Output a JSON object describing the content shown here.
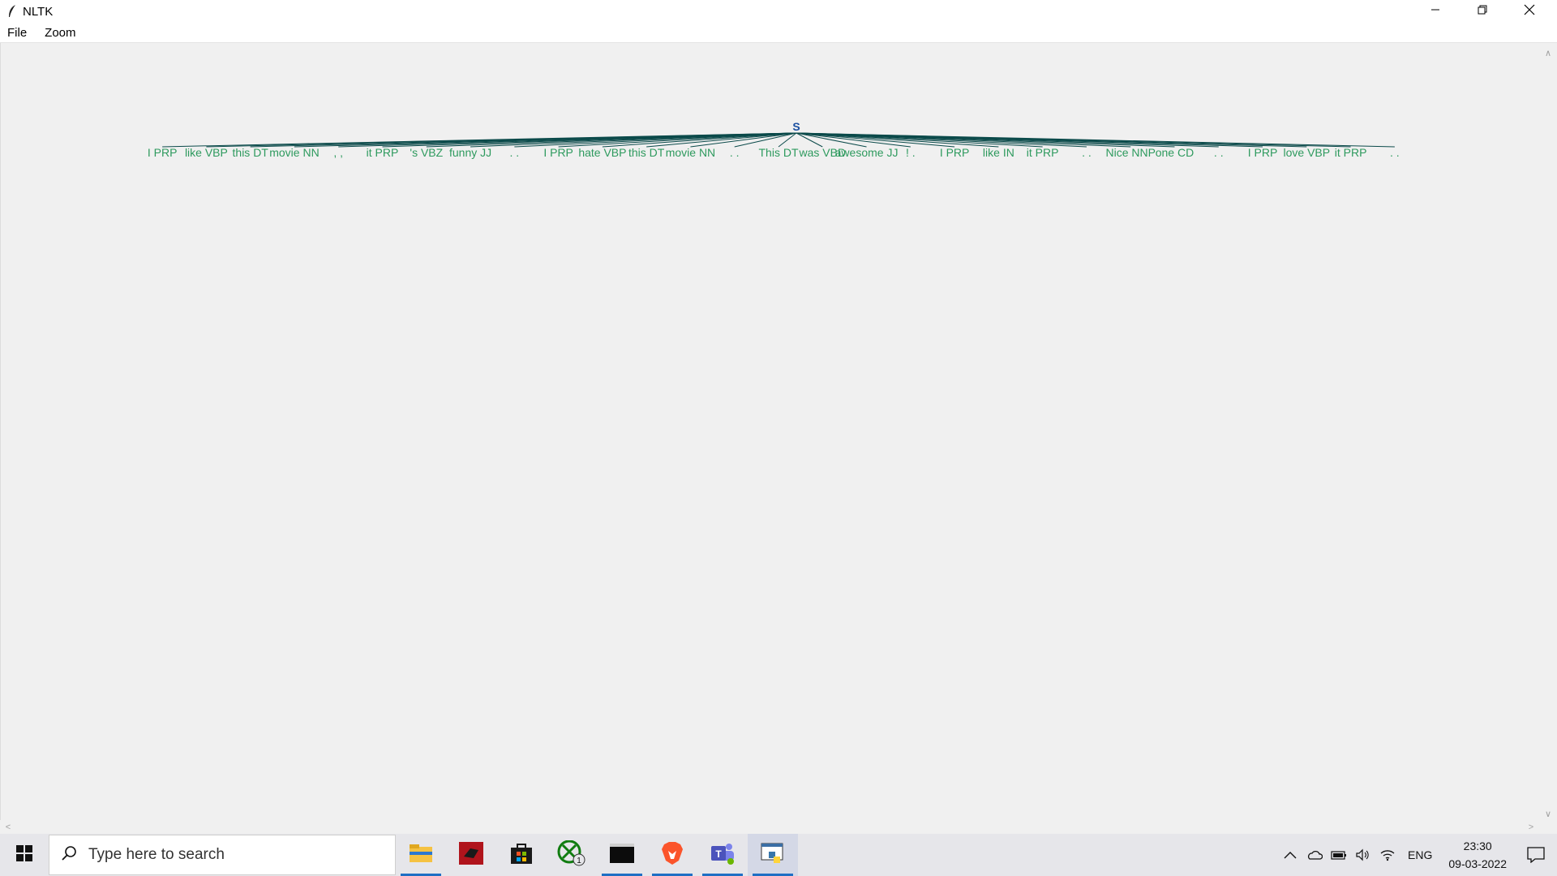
{
  "window": {
    "title": "NLTK",
    "controls": [
      "minimize",
      "restore",
      "close"
    ]
  },
  "menu": {
    "items": [
      {
        "label": "File"
      },
      {
        "label": "Zoom"
      }
    ]
  },
  "tree": {
    "root_label": "S",
    "leaves": [
      {
        "word": "I",
        "tag": "PRP"
      },
      {
        "word": "like",
        "tag": "VBP"
      },
      {
        "word": "this",
        "tag": "DT"
      },
      {
        "word": "movie",
        "tag": "NN"
      },
      {
        "word": ",",
        "tag": ","
      },
      {
        "word": "it",
        "tag": "PRP"
      },
      {
        "word": "'s",
        "tag": "VBZ"
      },
      {
        "word": "funny",
        "tag": "JJ"
      },
      {
        "word": ".",
        "tag": "."
      },
      {
        "word": "I",
        "tag": "PRP"
      },
      {
        "word": "hate",
        "tag": "VBP"
      },
      {
        "word": "this",
        "tag": "DT"
      },
      {
        "word": "movie",
        "tag": "NN"
      },
      {
        "word": ".",
        "tag": "."
      },
      {
        "word": "This",
        "tag": "DT"
      },
      {
        "word": "was",
        "tag": "VBD"
      },
      {
        "word": "awesome",
        "tag": "JJ"
      },
      {
        "word": "!",
        "tag": "."
      },
      {
        "word": "I",
        "tag": "PRP"
      },
      {
        "word": "like",
        "tag": "IN"
      },
      {
        "word": "it",
        "tag": "PRP"
      },
      {
        "word": ".",
        "tag": "."
      },
      {
        "word": "Nice",
        "tag": "NNP"
      },
      {
        "word": "one",
        "tag": "CD"
      },
      {
        "word": ".",
        "tag": "."
      },
      {
        "word": "I",
        "tag": "PRP"
      },
      {
        "word": "love",
        "tag": "VBP"
      },
      {
        "word": "it",
        "tag": "PRP"
      },
      {
        "word": ".",
        "tag": "."
      }
    ],
    "colors": {
      "root": "#1a4fa0",
      "leaf": "#2e9a5e",
      "branch": "#0b4a4a"
    }
  },
  "taskbar": {
    "search_placeholder": "Type here to search",
    "apps": [
      {
        "name": "file-explorer",
        "active": true
      },
      {
        "name": "app-red",
        "active": false
      },
      {
        "name": "microsoft-store",
        "active": false
      },
      {
        "name": "xbox",
        "active": false,
        "badge": "1"
      },
      {
        "name": "terminal",
        "active": true
      },
      {
        "name": "brave-browser",
        "active": true
      },
      {
        "name": "microsoft-teams",
        "active": true
      },
      {
        "name": "python-tk",
        "active": true
      }
    ],
    "language": "ENG",
    "time": "23:30",
    "date": "09-03-2022"
  }
}
